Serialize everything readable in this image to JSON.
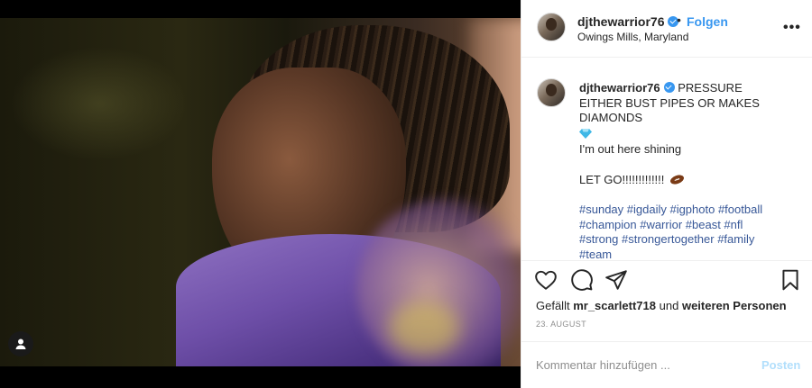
{
  "post": {
    "username": "djthewarrior76",
    "verified": true,
    "separator": "•",
    "follow_label": "Folgen",
    "location": "Owings Mills, Maryland",
    "more_icon": "more-icon"
  },
  "caption": {
    "username": "djthewarrior76",
    "line1": "PRESSURE EITHER BUST PIPES OR MAKES DIAMONDS",
    "line2": "I'm out here shining",
    "line3": "LET GO!!!!!!!!!!!!!",
    "hashtags_line1": "#sunday #igdaily #igphoto #football",
    "hashtags_line2": "#champion #warrior #beast #nfl",
    "hashtags_line3": "#strong #strongertogether #family",
    "hashtags_line4": "#team"
  },
  "actions": {
    "likes_prefix": "Gefällt",
    "likes_user": "mr_scarlett718",
    "likes_mid": "und",
    "likes_others": "weiteren Personen",
    "date": "23. AUGUST"
  },
  "comment_box": {
    "placeholder": "Kommentar hinzufügen ...",
    "post_label": "Posten"
  },
  "colors": {
    "accent": "#3897f0",
    "text": "#262626",
    "muted": "#8e8e8e",
    "post_disabled": "#b2dffc"
  }
}
